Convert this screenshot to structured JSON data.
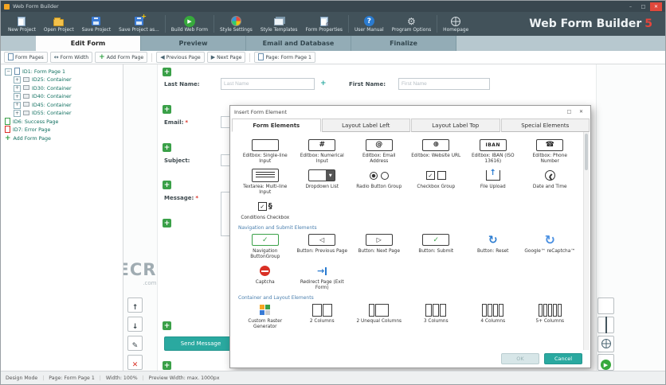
{
  "window": {
    "title": "Web Form Builder"
  },
  "brand": {
    "name": "Web Form Builder",
    "version": "5"
  },
  "toolbar": {
    "items": [
      {
        "label": "New Project",
        "icon": "new-project-icon"
      },
      {
        "label": "Open Project",
        "icon": "open-project-icon"
      },
      {
        "label": "Save Project",
        "icon": "save-project-icon"
      },
      {
        "label": "Save Project as...",
        "icon": "save-project-as-icon"
      },
      {
        "label": "Build Web Form",
        "icon": "build-web-form-icon"
      },
      {
        "label": "Style Settings",
        "icon": "style-settings-icon"
      },
      {
        "label": "Style Templates",
        "icon": "style-templates-icon"
      },
      {
        "label": "Form Properties",
        "icon": "form-properties-icon"
      },
      {
        "label": "User Manual",
        "icon": "user-manual-icon"
      },
      {
        "label": "Program Options",
        "icon": "program-options-icon"
      },
      {
        "label": "Homepage",
        "icon": "homepage-icon"
      }
    ]
  },
  "tabs": [
    {
      "label": "Edit Form",
      "active": true
    },
    {
      "label": "Preview",
      "active": false
    },
    {
      "label": "Email and Database",
      "active": false
    },
    {
      "label": "Finalize",
      "active": false
    }
  ],
  "pagebar": {
    "buttons": [
      {
        "label": "Form Pages",
        "icon": "form-pages-icon"
      },
      {
        "label": "Form Width",
        "icon": "form-width-icon"
      },
      {
        "label": "Add Form Page",
        "icon": "add-icon"
      },
      {
        "label": "Previous Page",
        "icon": "prev-icon"
      },
      {
        "label": "Next Page",
        "icon": "next-icon"
      },
      {
        "label": "Page: Form Page 1",
        "icon": "page-icon"
      }
    ]
  },
  "tree": {
    "items": [
      {
        "label": "ID1: Form Page 1",
        "level": 0,
        "expander": "minus",
        "icon": "form-page-icon"
      },
      {
        "label": "ID25: Container",
        "level": 1,
        "expander": "plus",
        "icon": "container-icon"
      },
      {
        "label": "ID30: Container",
        "level": 1,
        "expander": "plus",
        "icon": "container-icon"
      },
      {
        "label": "ID40: Container",
        "level": 1,
        "expander": "plus",
        "icon": "container-icon"
      },
      {
        "label": "ID45: Container",
        "level": 1,
        "expander": "plus",
        "icon": "container-icon"
      },
      {
        "label": "ID55: Container",
        "level": 1,
        "expander": "plus",
        "icon": "container-icon"
      },
      {
        "label": "ID6: Success Page",
        "level": 0,
        "expander": "none",
        "icon": "success-page-icon"
      },
      {
        "label": "ID7: Error Page",
        "level": 0,
        "expander": "none",
        "icon": "error-page-icon"
      },
      {
        "label": "Add Form Page",
        "level": 0,
        "expander": "none",
        "icon": "add-icon"
      }
    ]
  },
  "form": {
    "fields": {
      "last_name": {
        "label": "Last Name:",
        "placeholder": "Last Name"
      },
      "first_name": {
        "label": "First Name:",
        "placeholder": "First Name"
      },
      "email": {
        "label": "Email:",
        "required": "*"
      },
      "subject": {
        "label": "Subject:"
      },
      "message": {
        "label": "Message:",
        "required": "*"
      }
    },
    "submit_label": "Send Message",
    "plus_glyph": "+"
  },
  "dialog": {
    "title": "Insert Form Element",
    "tabs": [
      {
        "label": "Form Elements",
        "active": true
      },
      {
        "label": "Layout Label Left",
        "active": false
      },
      {
        "label": "Layout Label Top",
        "active": false
      },
      {
        "label": "Special Elements",
        "active": false
      }
    ],
    "sections": [
      {
        "header": "",
        "items": [
          {
            "label": "Editbox: Single-line Input",
            "icon": "editbox-icon"
          },
          {
            "label": "Editbox: Numerical Input",
            "icon": "numeric-editbox-icon"
          },
          {
            "label": "Editbox: Email Address",
            "icon": "email-editbox-icon"
          },
          {
            "label": "Editbox: Website URL",
            "icon": "url-editbox-icon"
          },
          {
            "label": "Editbox: IBAN (ISO 13616)",
            "icon": "iban-editbox-icon"
          },
          {
            "label": "Editbox: Phone Number",
            "icon": "phone-editbox-icon"
          },
          {
            "label": "Textarea: Multi-line Input",
            "icon": "textarea-icon"
          },
          {
            "label": "Dropdown List",
            "icon": "dropdown-icon"
          },
          {
            "label": "Radio Button Group",
            "icon": "radio-group-icon"
          },
          {
            "label": "Checkbox Group",
            "icon": "checkbox-group-icon"
          },
          {
            "label": "File Upload",
            "icon": "file-upload-icon"
          },
          {
            "label": "Date and Time",
            "icon": "date-time-icon"
          },
          {
            "label": "Conditions Checkbox",
            "icon": "conditions-checkbox-icon"
          }
        ]
      },
      {
        "header": "Navigation and Submit Elements",
        "items": [
          {
            "label": "Navigation ButtonGroup",
            "icon": "nav-buttongroup-icon"
          },
          {
            "label": "Button: Previous Page",
            "icon": "button-previous-icon"
          },
          {
            "label": "Button: Next Page",
            "icon": "button-next-icon"
          },
          {
            "label": "Button: Submit",
            "icon": "button-submit-icon"
          },
          {
            "label": "Button: Reset",
            "icon": "button-reset-icon"
          },
          {
            "label": "Google™ reCaptcha™",
            "icon": "recaptcha-icon"
          },
          {
            "label": "Captcha",
            "icon": "captcha-icon"
          },
          {
            "label": "Redirect Page (Exit Form)",
            "icon": "redirect-icon"
          }
        ]
      },
      {
        "header": "Container and Layout Elements",
        "items": [
          {
            "label": "Custom Raster Generator",
            "icon": "raster-generator-icon"
          },
          {
            "label": "2 Columns",
            "icon": "columns-2-icon"
          },
          {
            "label": "2 Unequal Columns",
            "icon": "columns-2u-icon"
          },
          {
            "label": "3 Columns",
            "icon": "columns-3-icon"
          },
          {
            "label": "4 Columns",
            "icon": "columns-4-icon"
          },
          {
            "label": "5+ Columns",
            "icon": "columns-5-icon"
          }
        ]
      }
    ],
    "ok_label": "OK",
    "cancel_label": "Cancel"
  },
  "side_tools": {
    "left": [
      {
        "icon": "arrow-up-icon"
      },
      {
        "icon": "arrow-down-icon"
      },
      {
        "icon": "edit-icon"
      },
      {
        "icon": "delete-icon"
      }
    ],
    "right": [
      {
        "icon": "adjust-icon"
      },
      {
        "icon": "grid-icon"
      },
      {
        "icon": "globe-icon"
      },
      {
        "icon": "run-icon"
      }
    ]
  },
  "statusbar": {
    "items": [
      "Design Mode",
      "Page: Form Page 1",
      "Width: 100%",
      "Preview Width: max. 1000px"
    ]
  },
  "watermark": {
    "title": "FILECR",
    "sub": ".com"
  },
  "colors": {
    "accent": "#2aa9a0",
    "brand_red": "#e8453c",
    "green": "#3aa048"
  }
}
